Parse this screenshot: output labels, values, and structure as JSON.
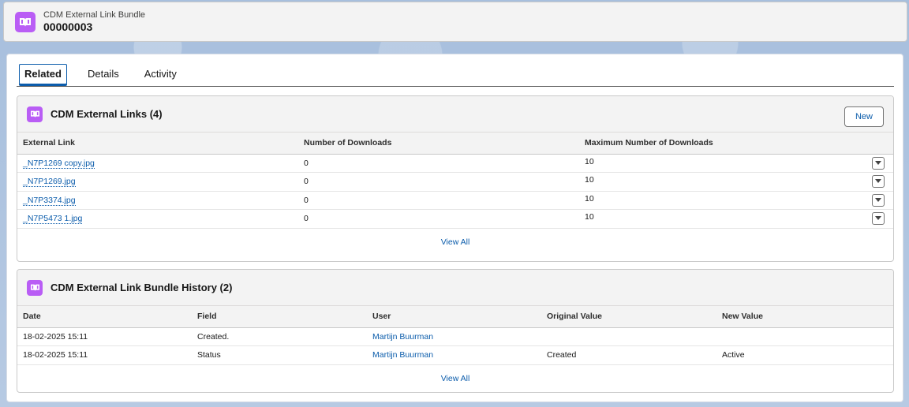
{
  "header": {
    "object_label": "CDM External Link Bundle",
    "record_name": "00000003",
    "icon": "book-icon"
  },
  "tabs": [
    {
      "label": "Related",
      "active": true
    },
    {
      "label": "Details",
      "active": false
    },
    {
      "label": "Activity",
      "active": false
    }
  ],
  "links_card": {
    "title": "CDM External Links (4)",
    "new_label": "New",
    "columns": [
      "External Link",
      "Number of Downloads",
      "Maximum Number of Downloads"
    ],
    "rows": [
      {
        "link": "_N7P1269 copy.jpg",
        "downloads": "0",
        "max": "10"
      },
      {
        "link": "_N7P1269.jpg",
        "downloads": "0",
        "max": "10"
      },
      {
        "link": "_N7P3374.jpg",
        "downloads": "0",
        "max": "10"
      },
      {
        "link": "_N7P5473 1.jpg",
        "downloads": "0",
        "max": "10"
      }
    ],
    "view_all": "View All"
  },
  "history_card": {
    "title": "CDM External Link Bundle History (2)",
    "columns": [
      "Date",
      "Field",
      "User",
      "Original Value",
      "New Value"
    ],
    "rows": [
      {
        "date": "18-02-2025 15:11",
        "field": "Created.",
        "user": "Martijn Buurman",
        "original": "",
        "new": ""
      },
      {
        "date": "18-02-2025 15:11",
        "field": "Status",
        "user": "Martijn Buurman",
        "original": "Created",
        "new": "Active"
      }
    ],
    "view_all": "View All"
  },
  "colors": {
    "accent": "#0b5cab",
    "object_icon": "#b95df5"
  }
}
